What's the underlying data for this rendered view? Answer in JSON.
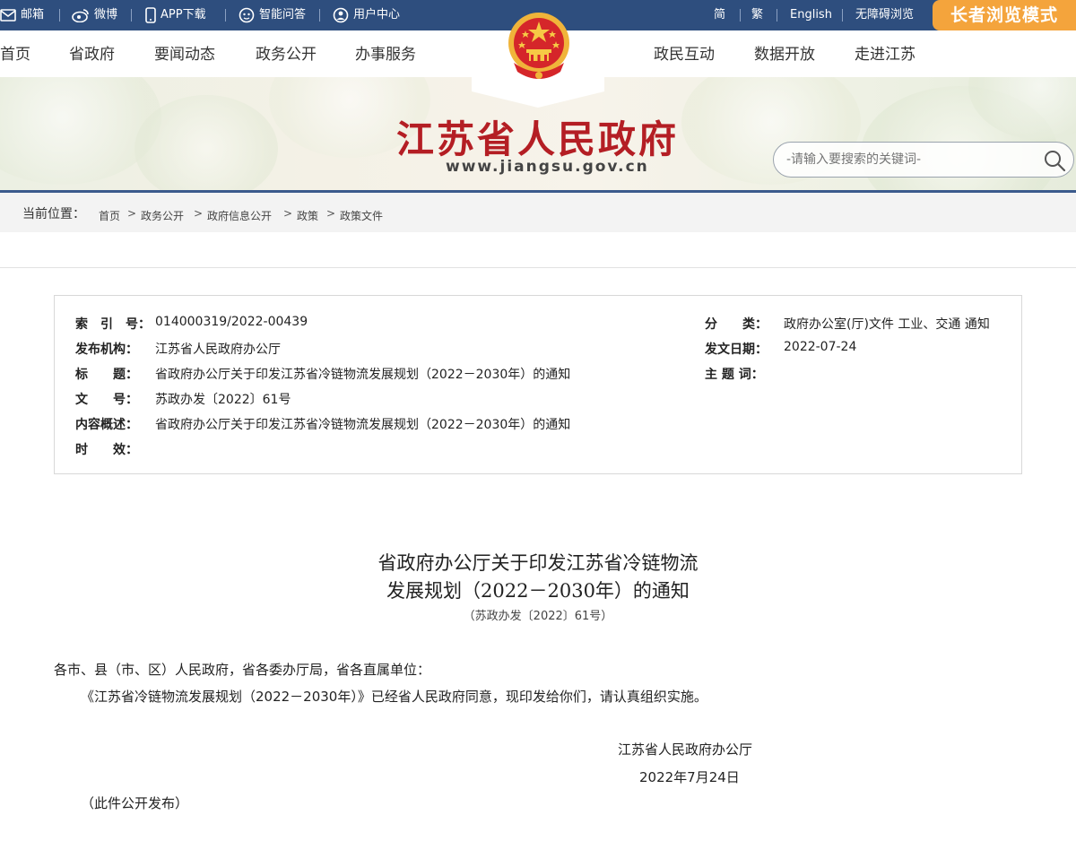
{
  "topbar": {
    "mail": "邮箱",
    "weibo": "微博",
    "app": "APP下载",
    "qa": "智能问答",
    "user": "用户中心",
    "simplified": "简",
    "traditional": "繁",
    "english": "English",
    "accessible": "无障碍浏览",
    "elder_mode": "长者浏览模式"
  },
  "nav": {
    "items_left": [
      "首页",
      "省政府",
      "要闻动态",
      "政务公开",
      "办事服务"
    ],
    "items_right": [
      "政民互动",
      "数据开放",
      "走进江苏"
    ]
  },
  "banner": {
    "title": "江苏省人民政府",
    "url": "www.jiangsu.gov.cn",
    "search_placeholder": "-请输入要搜索的关键词-"
  },
  "breadcrumb": {
    "label": "当前位置：",
    "items": [
      "首页",
      "政务公开",
      "政府信息公开",
      "政策",
      "政策文件"
    ]
  },
  "meta": {
    "index_label": "索　引　号：",
    "index_value": "014000319/2022-00439",
    "publisher_label": "发布机构：",
    "publisher_value": "江苏省人民政府办公厅",
    "title_label": "标　　题：",
    "title_value": "省政府办公厅关于印发江苏省冷链物流发展规划（2022－2030年）的通知",
    "docno_label": "文　　号：",
    "docno_value": "苏政办发〔2022〕61号",
    "summary_label": "内容概述：",
    "summary_value": "省政府办公厅关于印发江苏省冷链物流发展规划（2022－2030年）的通知",
    "validity_label": "时　　效：",
    "validity_value": "",
    "category_label": "分　　类：",
    "category_value": "政府办公室(厅)文件 工业、交通 通知",
    "date_label": "发文日期：",
    "date_value": "2022-07-24",
    "keywords_label": "主 题 词：",
    "keywords_value": ""
  },
  "article": {
    "title_line1": "省政府办公厅关于印发江苏省冷链物流",
    "title_line2": "发展规划（2022－2030年）的通知",
    "doc_number": "（苏政办发〔2022〕61号）",
    "salutation": "各市、县（市、区）人民政府，省各委办厅局，省各直属单位：",
    "body": "《江苏省冷链物流发展规划（2022－2030年）》已经省人民政府同意，现印发给你们，请认真组织实施。",
    "signature": "江苏省人民政府办公厅",
    "sign_date": "2022年7月24日",
    "note": "（此件公开发布）"
  },
  "colors": {
    "topbar": "#2e4e7e",
    "elder": "#f4a43c",
    "title_red": "#b41e24"
  }
}
